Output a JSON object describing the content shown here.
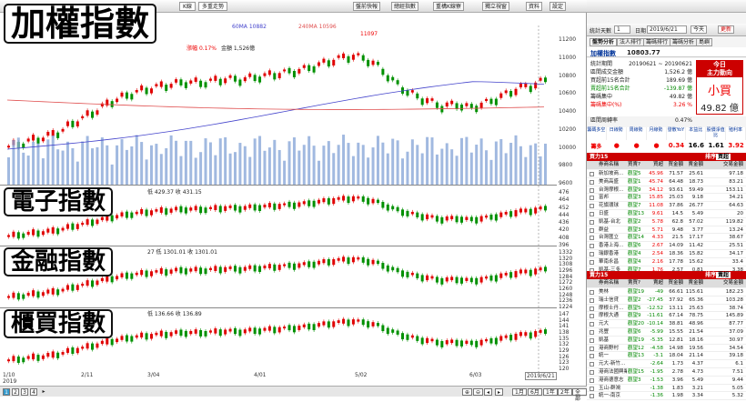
{
  "toolbar": {
    "tab_k": "K線",
    "tab_multi": "多重走勢",
    "buttons": [
      "盤前快報",
      "總經指數",
      "重構K線寮",
      "獨立視窗",
      "資料",
      "設定"
    ]
  },
  "ma_legend": {
    "ma60": "60MA 10882",
    "ma240": "240MA 10596",
    "ma60_color": "#4444cc",
    "ma240_color": "#e05050"
  },
  "main_info": {
    "change_label": "漲幅",
    "change_value": "0.17%",
    "volume": "金額 1,526億"
  },
  "panels": [
    {
      "title": "加權指數",
      "y_ticks": [
        "11200",
        "11000",
        "10800",
        "10600",
        "10400",
        "10200",
        "10000",
        "9800",
        "9600"
      ],
      "peak_label": "11097"
    },
    {
      "title": "電子指數",
      "info": "低 429.37  收 431.15",
      "y_ticks": [
        "476",
        "464",
        "452",
        "444",
        "436",
        "420",
        "408",
        "396"
      ]
    },
    {
      "title": "金融指數",
      "info": "27  低 1301.01  收 1301.01",
      "y_ticks": [
        "1332",
        "1320",
        "1308",
        "1296",
        "1284",
        "1272",
        "1260",
        "1248",
        "1236",
        "1224"
      ]
    },
    {
      "title": "櫃買指數",
      "info": "低 136.66  收 136.89",
      "y_ticks": [
        "147",
        "144",
        "141",
        "138",
        "135",
        "132",
        "129",
        "126",
        "123",
        "120"
      ]
    }
  ],
  "x_ticks": [
    "1/10",
    "2/11",
    "3/04",
    "4/01",
    "5/02",
    "6/03"
  ],
  "x_year": "2019",
  "cursor_date": "2019/6/21",
  "bottom": {
    "pages": [
      "1",
      "2",
      "3",
      "4"
    ],
    "ranges": [
      "1月",
      "6月",
      "1年",
      "2年",
      "全部"
    ]
  },
  "right": {
    "period_label": "統計天數",
    "period_value": "1",
    "date_label": "日期",
    "date_value": "2019/6/21",
    "today_btn": "今天",
    "refresh_btn": "更新",
    "subtabs": [
      "盤勢分析",
      "法人排行",
      "籌碼排行",
      "籌碼分析",
      "島嶼"
    ],
    "index_name": "加權指數",
    "index_value": "10803.77",
    "stats": [
      {
        "k": "統計期間",
        "v": "20190621 ~ 20190621",
        "c": ""
      },
      {
        "k": "區間成交金額",
        "v": "1,526.2 億",
        "c": ""
      },
      {
        "k": "買超前15名合計",
        "v": "189.69 億",
        "c": ""
      },
      {
        "k": "賣超前15名合計",
        "v": "-139.87 億",
        "c": "green"
      },
      {
        "k": "籌碼集中",
        "v": "49.82 億",
        "c": ""
      },
      {
        "k": "籌碼集中(%)",
        "v": "3.26 %",
        "c": "red"
      }
    ],
    "today_box": {
      "line1": "今日",
      "line2": "主力動向",
      "verdict": "小買",
      "amount": "49.82 億"
    },
    "turnover": {
      "k": "區間周轉率",
      "v": "0.47%"
    },
    "indicator_heads": [
      "籌碼多空",
      "日線勢",
      "周線勢",
      "月線勢",
      "發散YoY",
      "本益比",
      "股價淨值比",
      "殖利率"
    ],
    "indicator_row_label": "籌多",
    "indicator_values": [
      "",
      "",
      "",
      "",
      "0.34",
      "16.6",
      "1.61",
      "3.92"
    ],
    "buy": {
      "title": "買力15",
      "sort_label": "排序:",
      "sort_value": "買超",
      "columns": [
        "",
        "券商名稱",
        "買賣?",
        "買超",
        "買金額",
        "賣金額",
        "交易金額"
      ],
      "rows": [
        [
          "新加坡商...",
          "觀望5",
          "45.96",
          "71.57",
          "25.61",
          "97.18"
        ],
        [
          "美商高盛",
          "觀望1",
          "45.74",
          "64.48",
          "18.73",
          "83.21"
        ],
        [
          "台灣摩根...",
          "觀望9",
          "34.12",
          "93.61",
          "59.49",
          "153.11"
        ],
        [
          "富邦",
          "觀望3",
          "15.85",
          "25.03",
          "9.18",
          "34.21"
        ],
        [
          "花旗環球",
          "觀望7",
          "11.08",
          "37.86",
          "26.77",
          "64.63"
        ],
        [
          "日盛",
          "觀望13",
          "9.61",
          "14.5",
          "5.49",
          "20"
        ],
        [
          "凱基-台北",
          "觀望2",
          "5.78",
          "62.8",
          "57.02",
          "119.82"
        ],
        [
          "群益",
          "觀望3",
          "5.71",
          "9.48",
          "3.77",
          "13.24"
        ],
        [
          "台灣匯立",
          "觀望14",
          "4.33",
          "21.5",
          "17.17",
          "38.67"
        ],
        [
          "香港上海...",
          "觀望6",
          "2.67",
          "14.09",
          "11.42",
          "25.51"
        ],
        [
          "瑞銀香港",
          "觀望4",
          "2.54",
          "18.36",
          "15.82",
          "34.17"
        ],
        [
          "華南永昌",
          "觀望4",
          "2.16",
          "17.78",
          "15.62",
          "33.4"
        ],
        [
          "凱基-三多",
          "觀望7",
          "1.76",
          "2.57",
          "0.81",
          "3.38"
        ]
      ]
    },
    "sell": {
      "title": "賣力15",
      "sort_label": "排序:",
      "sort_value": "賣超",
      "columns": [
        "",
        "券商名稱",
        "賣買?",
        "賣超",
        "買金額",
        "賣金額",
        "交易金額"
      ],
      "rows": [
        [
          "美林",
          "觀望19",
          "-49",
          "66.61",
          "115.61",
          "182.23"
        ],
        [
          "瑞士信貸",
          "觀望2",
          "-27.45",
          "37.92",
          "65.36",
          "103.28"
        ],
        [
          "摩根士丹...",
          "觀望5",
          "-12.52",
          "13.11",
          "25.63",
          "38.74"
        ],
        [
          "摩根大通",
          "觀望9",
          "-11.61",
          "67.14",
          "78.75",
          "145.89"
        ],
        [
          "元大",
          "觀望20",
          "-10.14",
          "38.81",
          "48.96",
          "87.77"
        ],
        [
          "兆豐",
          "觀望6",
          "-5.99",
          "15.55",
          "21.54",
          "37.09"
        ],
        [
          "凱基",
          "觀望19",
          "-5.35",
          "12.81",
          "18.16",
          "30.97"
        ],
        [
          "港商野村",
          "觀望12",
          "-4.58",
          "14.98",
          "19.56",
          "34.54"
        ],
        [
          "統一",
          "觀望13",
          "-3.1",
          "18.04",
          "21.14",
          "39.18"
        ],
        [
          "元大-新竹...",
          "",
          "-2.64",
          "1.73",
          "4.37",
          "6.1"
        ],
        [
          "港商法國興業",
          "觀望15",
          "-1.95",
          "2.78",
          "4.73",
          "7.51"
        ],
        [
          "港商德意志",
          "觀望3",
          "-1.53",
          "3.96",
          "5.49",
          "9.44"
        ],
        [
          "玉山-群鴻",
          "",
          "-1.38",
          "1.83",
          "3.21",
          "5.05"
        ],
        [
          "統一-南京",
          "",
          "-1.36",
          "1.98",
          "3.34",
          "5.32"
        ]
      ]
    }
  }
}
